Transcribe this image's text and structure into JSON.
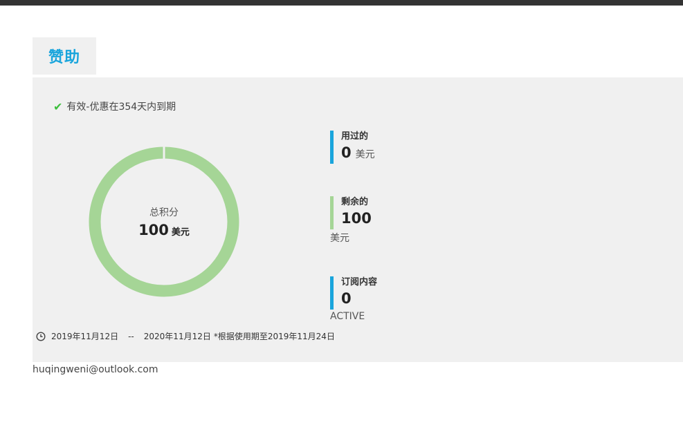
{
  "header": {
    "tab_label": "赞助"
  },
  "status": {
    "text": "有效-优惠在354天内到期"
  },
  "donut": {
    "label": "总积分",
    "value": "100",
    "unit": "美元",
    "ring_color": "#a5d596"
  },
  "stats": {
    "used": {
      "title": "用过的",
      "value": "0",
      "unit": "美元",
      "bar_color": "#1aa5dc"
    },
    "remaining": {
      "title": "剩余的",
      "value": "100",
      "unit": "美元",
      "bar_color": "#a5d596"
    },
    "subscription": {
      "title": "订阅内容",
      "value": "0",
      "status": "ACTIVE",
      "bar_color": "#1aa5dc"
    }
  },
  "dates": {
    "start": "2019年11月12日",
    "separator": "--",
    "end": "2020年11月12日",
    "note": "*根据使用期至2019年11月24日"
  },
  "account": {
    "email": "huqingweni@outlook.com"
  }
}
